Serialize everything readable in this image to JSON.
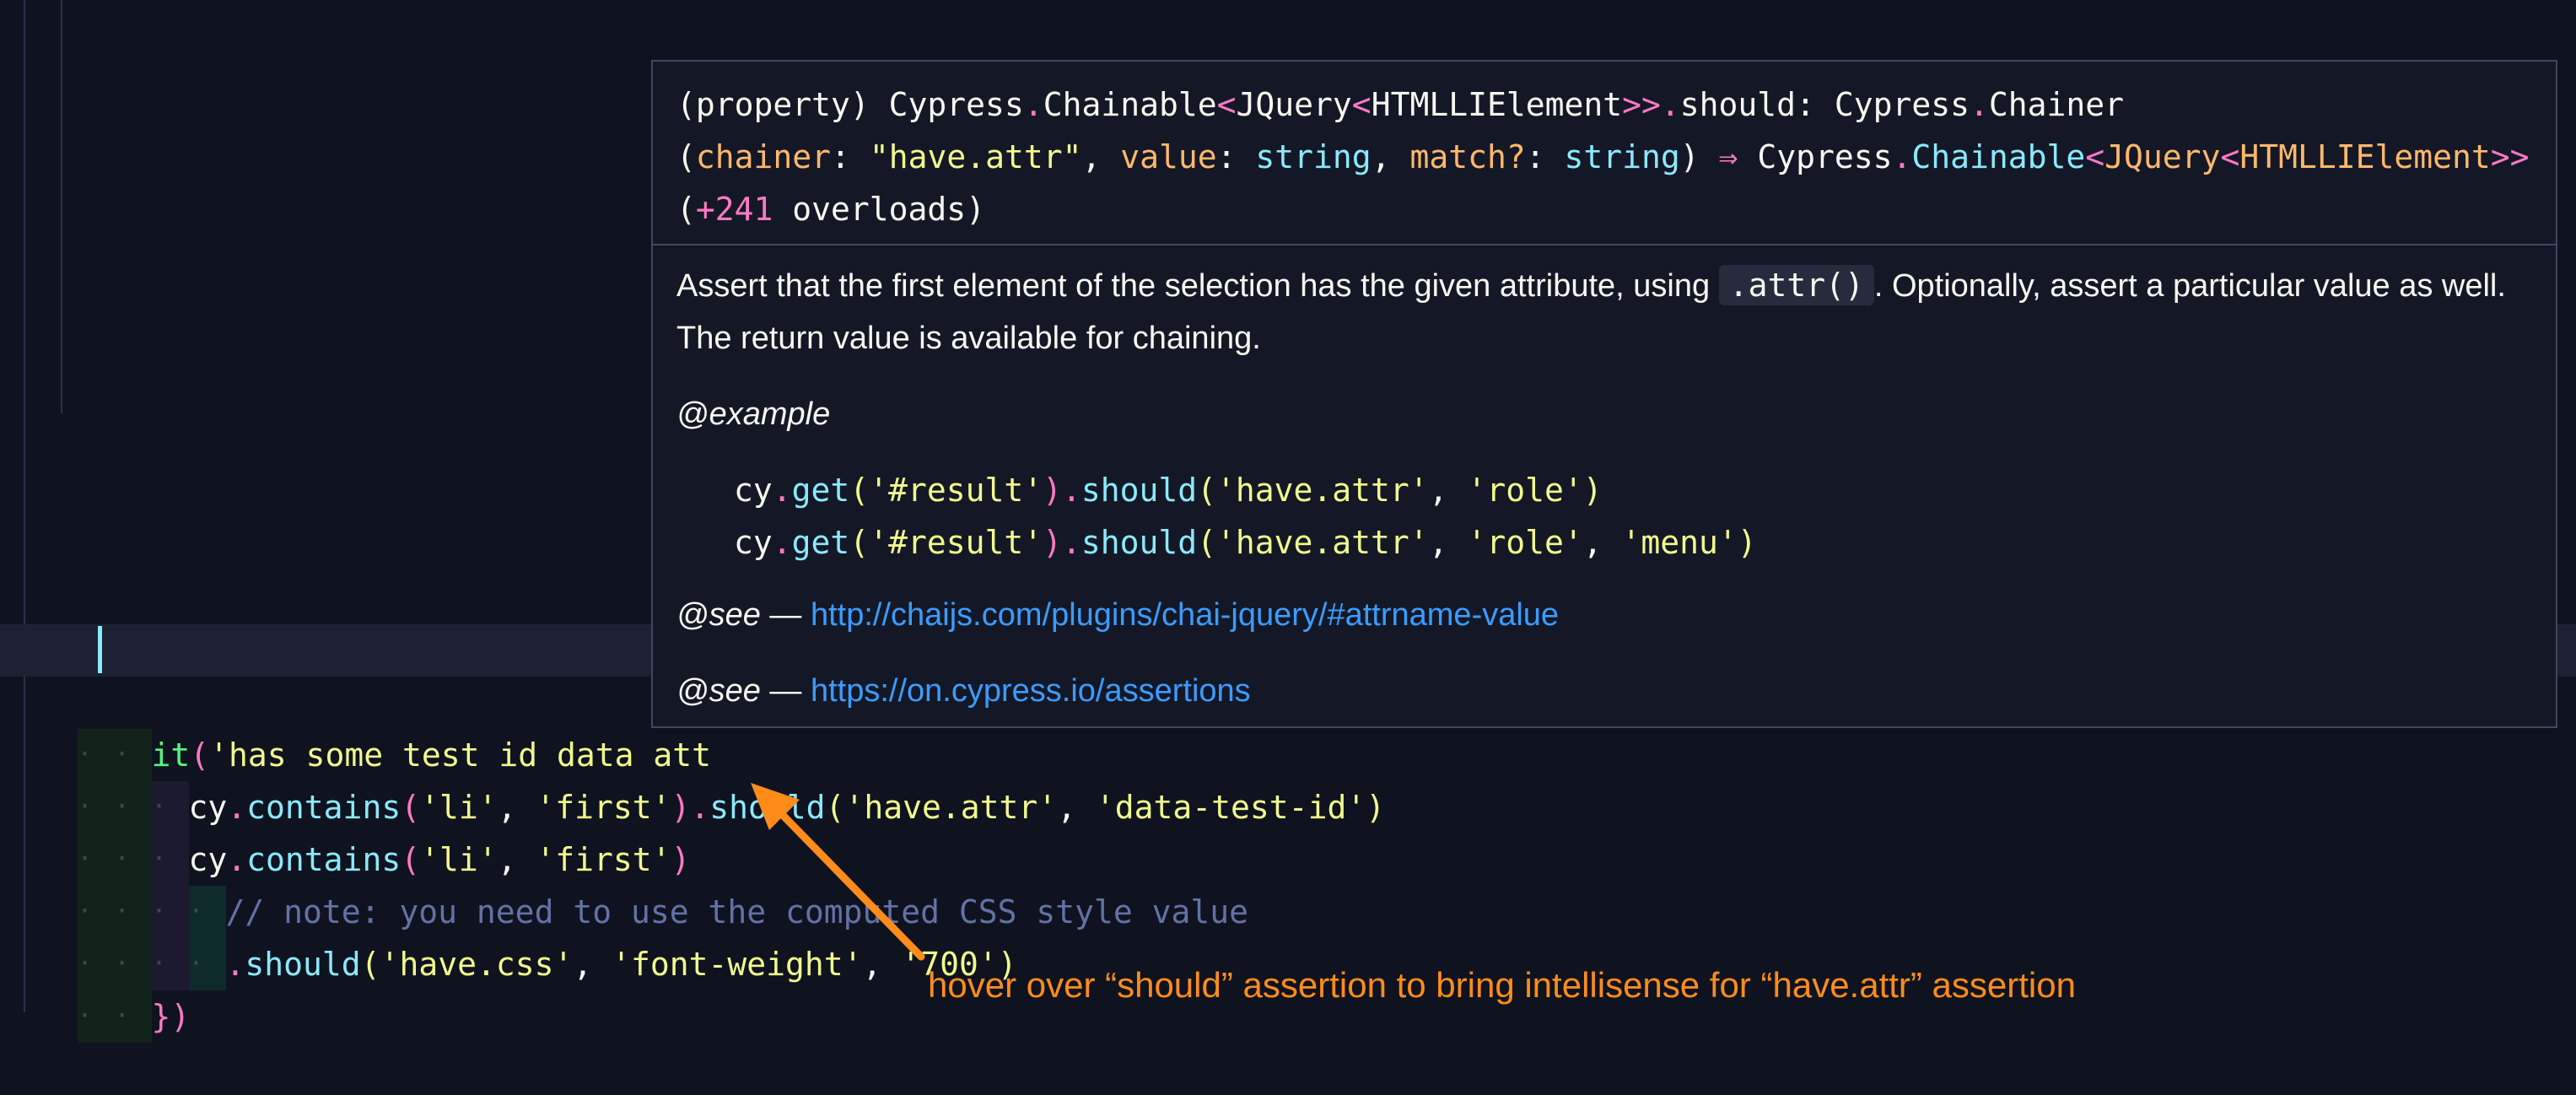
{
  "tooltip": {
    "sig_line1": [
      "(property) ",
      "Cypress",
      ".",
      "Chainable",
      "<",
      "JQuery",
      "<",
      "HTMLLIElement",
      ">>",
      ".",
      "should",
      ": ",
      "Cypress",
      ".",
      "Chainer"
    ],
    "sig_line2": [
      "(",
      "chainer",
      ": ",
      "\"have.attr\"",
      ", ",
      "value",
      ": ",
      "string",
      ", ",
      "match?",
      ": ",
      "string",
      ") ",
      "⇒",
      " Cypress",
      ".",
      "Chainable",
      "<",
      "JQuery",
      "<",
      "HTMLLIElement",
      ">>"
    ],
    "sig_line3": [
      "(",
      "+241",
      " overloads)"
    ],
    "desc_before": "Assert that the first element of the selection has the given attribute, using ",
    "desc_code": ".attr()",
    "desc_after": ". Optionally, assert a particular value as well. The return value is available for chaining.",
    "example_tag": "@example",
    "example_lines": [
      [
        "cy",
        ".",
        "get",
        "(",
        "'#result'",
        ").",
        "should",
        "(",
        "'have.attr'",
        ", ",
        "'role'",
        ")"
      ],
      [
        "cy",
        ".",
        "get",
        "(",
        "'#result'",
        ").",
        "should",
        "(",
        "'have.attr'",
        ", ",
        "'role'",
        ", ",
        "'menu'",
        ")"
      ]
    ],
    "see_tag": "@see",
    "see_dash": " — ",
    "see_link_1": "http://chaijs.com/plugins/chai-jquery/#attrname-value",
    "see_link_2": "https://on.cypress.io/assertions"
  },
  "code": {
    "line1": [
      "it",
      "(",
      "'has some test id data att"
    ],
    "line2": [
      "cy",
      ".",
      "contains",
      "(",
      "'li'",
      ", ",
      "'first'",
      ").",
      "should",
      "(",
      "'have.attr'",
      ", ",
      "'data-test-id'",
      ")"
    ],
    "line3": [
      "cy",
      ".",
      "contains",
      "(",
      "'li'",
      ", ",
      "'first'",
      ")"
    ],
    "line4": "// note: you need to use the computed CSS style value",
    "line5": [
      ".",
      "should",
      "(",
      "'have.css'",
      ", ",
      "'font-weight'",
      ", ",
      "'700'",
      ")"
    ],
    "line6": [
      "})"
    ]
  },
  "annotation": "hover over “should” assertion to bring intellisense for “have.attr” assertion",
  "colors": {
    "accent_orange": "#ff8c1a",
    "link_blue": "#3b9cff",
    "editor_bg": "#0f1320"
  }
}
